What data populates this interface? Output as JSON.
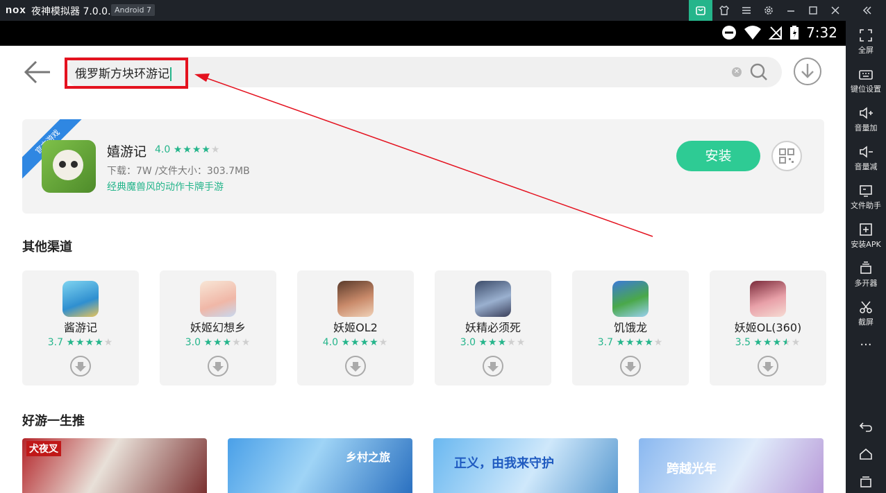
{
  "window": {
    "logo": "nox",
    "title": "夜神模拟器 7.0.0.6",
    "android": "Android 7"
  },
  "statusbar": {
    "time": "7:32"
  },
  "search": {
    "value": "俄罗斯方块环游记"
  },
  "featured": {
    "ribbon": "官方游戏",
    "name": "嬉游记",
    "rating": "4.0",
    "stars": 4,
    "meta": "下载：7W /文件大小：303.7MB",
    "desc": "经典魔兽风的动作卡牌手游",
    "install_label": "安装"
  },
  "sections": {
    "other_channels": "其他渠道",
    "recommend": "好游一生推"
  },
  "channels": [
    {
      "name": "酱游记",
      "rating": "3.7",
      "stars": 4
    },
    {
      "name": "妖姬幻想乡",
      "rating": "3.0",
      "stars": 3
    },
    {
      "name": "妖姬OL2",
      "rating": "4.0",
      "stars": 4
    },
    {
      "name": "妖精必须死",
      "rating": "3.0",
      "stars": 3
    },
    {
      "name": "饥饿龙",
      "rating": "3.7",
      "stars": 4
    },
    {
      "name": "妖姬OL(360)",
      "rating": "3.5",
      "stars": 3.5
    }
  ],
  "banners": [
    {
      "text": "犬夜叉"
    },
    {
      "text": "乡村之旅"
    },
    {
      "text": "正义，由我来守护"
    },
    {
      "text": "跨越光年"
    }
  ],
  "sidebar": [
    {
      "label": "全屏",
      "icon": "fullscreen-icon"
    },
    {
      "label": "键位设置",
      "icon": "keyboard-icon"
    },
    {
      "label": "音量加",
      "icon": "volume-up-icon"
    },
    {
      "label": "音量减",
      "icon": "volume-down-icon"
    },
    {
      "label": "文件助手",
      "icon": "file-helper-icon"
    },
    {
      "label": "安装APK",
      "icon": "install-apk-icon"
    },
    {
      "label": "多开器",
      "icon": "multi-instance-icon"
    },
    {
      "label": "截屏",
      "icon": "screenshot-icon"
    }
  ],
  "colors": {
    "accent": "#2ecb94",
    "highlight_red": "#e4121f",
    "chrome": "#1f2329"
  }
}
